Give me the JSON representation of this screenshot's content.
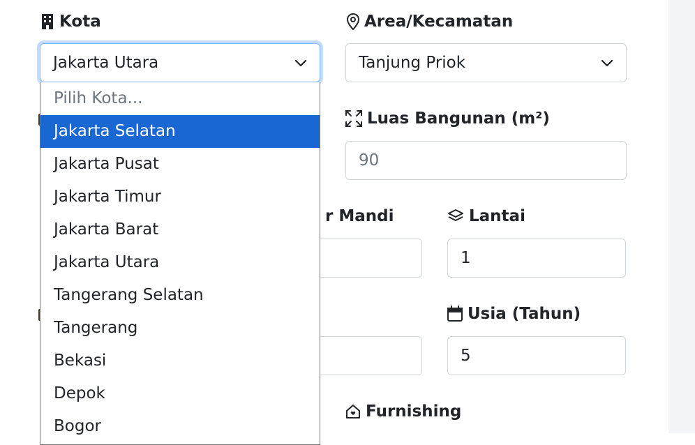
{
  "fields": {
    "kota": {
      "label": "Kota",
      "value": "Jakarta Utara"
    },
    "area": {
      "label": "Area/Kecamatan",
      "value": "Tanjung Priok"
    },
    "luas_bangunan": {
      "label": "Luas Bangunan (m²)",
      "placeholder": "90"
    },
    "kamar_mandi": {
      "label_partial": "r Mandi",
      "value": ""
    },
    "lantai": {
      "label": "Lantai",
      "value": "1"
    },
    "usia": {
      "label": "Usia (Tahun)",
      "value": "5"
    },
    "furnishing": {
      "label": "Furnishing"
    }
  },
  "kota_dropdown": {
    "options": [
      "Pilih Kota...",
      "Jakarta Selatan",
      "Jakarta Pusat",
      "Jakarta Timur",
      "Jakarta Barat",
      "Jakarta Utara",
      "Tangerang Selatan",
      "Tangerang",
      "Bekasi",
      "Depok",
      "Bogor"
    ],
    "highlighted": "Jakarta Selatan"
  },
  "colors": {
    "highlight": "#1967d2",
    "focus_border": "#86b7fe",
    "border": "#ced4da",
    "gutter": "#f3f4f6"
  }
}
